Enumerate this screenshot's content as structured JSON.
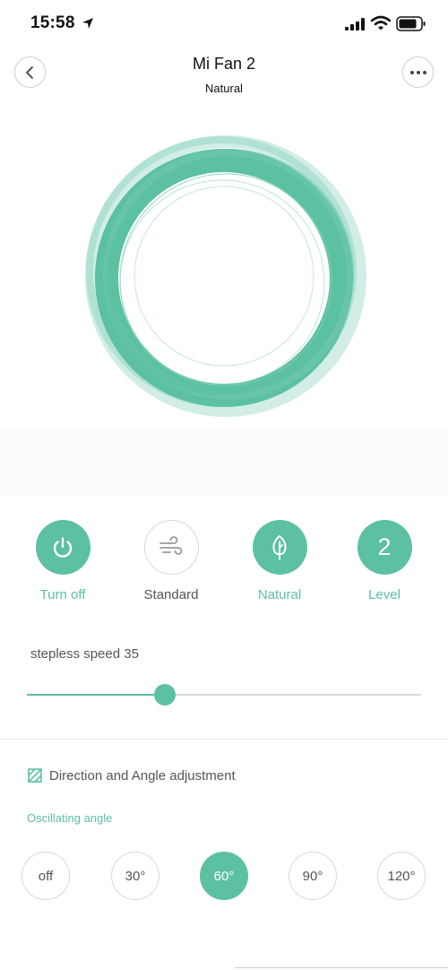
{
  "status_bar": {
    "time": "15:58",
    "icons": [
      "location-arrow-icon",
      "cellular-signal-icon",
      "wifi-icon",
      "battery-icon"
    ]
  },
  "header": {
    "title": "Mi Fan 2",
    "subtitle": "Natural",
    "back_icon": "chevron-left-icon",
    "more_icon": "ellipsis-icon"
  },
  "modes": [
    {
      "label": "Turn off",
      "icon": "power-icon",
      "active": true
    },
    {
      "label": "Standard",
      "icon": "wind-icon",
      "active": false
    },
    {
      "label": "Natural",
      "icon": "leaf-icon",
      "active": true
    },
    {
      "label": "Level",
      "value": "2",
      "active": true
    }
  ],
  "speed": {
    "label": "stepless speed 35",
    "value": 35,
    "min": 0,
    "max": 100
  },
  "direction": {
    "icon": "angle-adjust-icon",
    "title": "Direction and Angle adjustment",
    "oscillating_label": "Oscillating angle",
    "angles": [
      {
        "label": "off",
        "active": false
      },
      {
        "label": "30°",
        "active": false
      },
      {
        "label": "60°",
        "active": true
      },
      {
        "label": "90°",
        "active": false
      },
      {
        "label": "120°",
        "active": false
      }
    ]
  },
  "colors": {
    "accent": "#5cc0a3",
    "ring_light": "#cdebe3",
    "inactive_border": "#d9d9d9",
    "text_gray": "#555555"
  }
}
